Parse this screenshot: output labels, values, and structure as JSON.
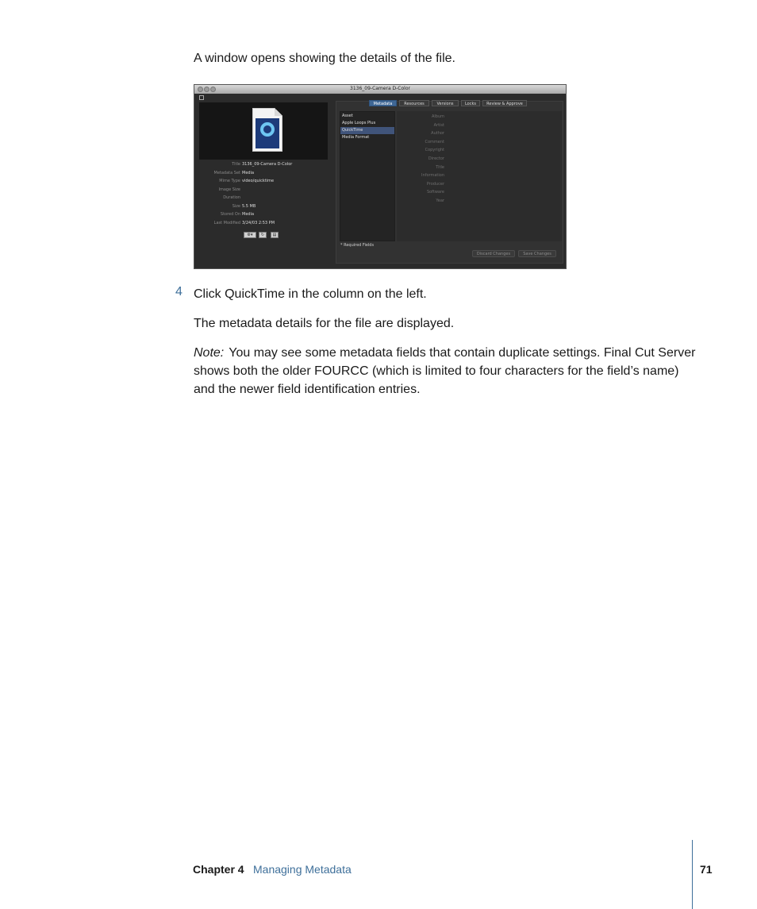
{
  "intro_text": "A window opens showing the details of the file.",
  "step": {
    "number": "4",
    "text": "Click QuickTime in the column on the left."
  },
  "result_text": "The metadata details for the file are displayed.",
  "note": {
    "label": "Note:",
    "text": "You may see some metadata fields that contain duplicate settings. Final Cut Server shows both the older FOURCC (which is limited to four characters for the field’s name) and the newer field identification entries."
  },
  "screenshot": {
    "window_title": "3136_09-Camera D-Color",
    "properties": [
      {
        "key": "Title",
        "value": "3136_09-Camera D-Color"
      },
      {
        "key": "Metadata Set",
        "value": "Media"
      },
      {
        "key": "Mime Type",
        "value": "video/quicktime"
      },
      {
        "key": "Image Size",
        "value": ""
      },
      {
        "key": "Duration",
        "value": ""
      },
      {
        "key": "Size",
        "value": "5.5 MB"
      },
      {
        "key": "Stored On",
        "value": "Media"
      },
      {
        "key": "Last Modified",
        "value": "3/24/03 2:53 PM"
      }
    ],
    "tabs": [
      "Metadata",
      "Resources",
      "Versions",
      "Locks",
      "Review & Approve"
    ],
    "groups": [
      "Asset",
      "Apple Loops Plus",
      "QuickTime",
      "Media Format"
    ],
    "fields": [
      "Album",
      "Artist",
      "Author",
      "Comment",
      "Copyright",
      "Director",
      "Title",
      "Information",
      "Producer",
      "Software",
      "Year"
    ],
    "required_note": "* Required Fields",
    "discard_button": "Discard Changes",
    "save_button": "Save Changes"
  },
  "footer": {
    "chapter": "Chapter 4",
    "title": "Managing Metadata",
    "page": "71"
  }
}
